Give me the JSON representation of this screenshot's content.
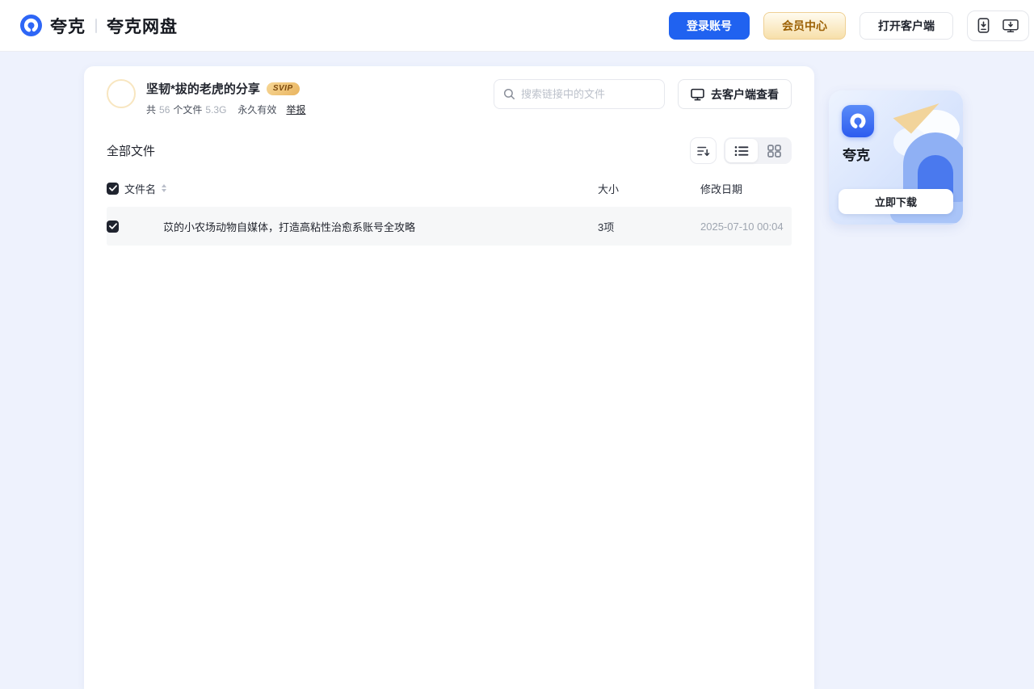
{
  "header": {
    "logo_text": "夸克",
    "product_name": "夸克网盘",
    "login_button": "登录账号",
    "member_button": "会员中心",
    "open_client_button": "打开客户端"
  },
  "share": {
    "title": "坚韧*拔的老虎的分享",
    "badge": "SVIP",
    "meta_prefix": "共",
    "file_count": "56",
    "meta_unit": "个文件",
    "total_size": "5.3G",
    "validity": "永久有效",
    "report_link": "举报",
    "search_placeholder": "搜索链接中的文件",
    "view_in_client_button": "去客户端查看"
  },
  "files": {
    "section_title": "全部文件",
    "columns": {
      "name": "文件名",
      "size": "大小",
      "modified": "修改日期"
    },
    "rows": [
      {
        "name": "苡的小农场动物自媒体，打造高粘性治愈系账号全攻略",
        "size": "3项",
        "modified": "2025-07-10 00:04",
        "selected": true
      }
    ]
  },
  "promo": {
    "app_name": "夸克",
    "download_button": "立即下载"
  },
  "colors": {
    "brand_blue": "#2062F0",
    "logo_blue": "#2E66F6",
    "member_gold_bg": "#F7DFA9",
    "member_gold_text": "#9C6104",
    "svip_gold": "#E9B45F",
    "page_background": "#EEF2FD",
    "selected_row_background": "#F6F7F8"
  }
}
